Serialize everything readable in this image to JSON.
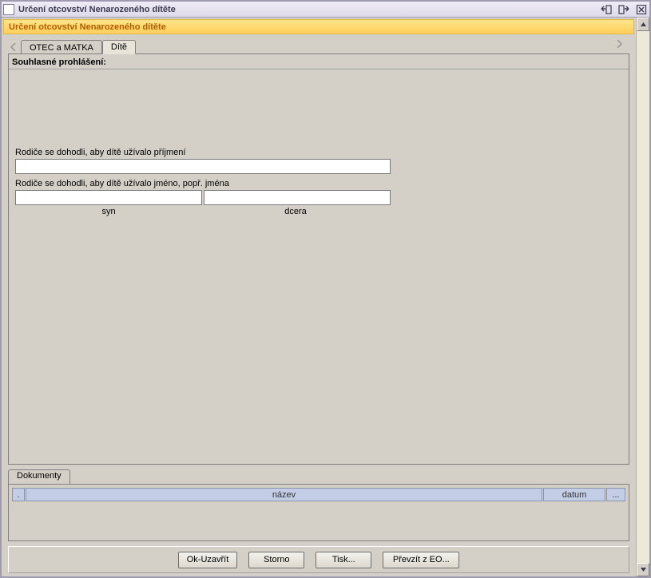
{
  "window": {
    "title": "Určení otcovství Nenarozeného dítěte"
  },
  "banner": {
    "text": "Určení otcovství Nenarozeného dítěte"
  },
  "tabs": [
    {
      "id": "parents",
      "label": "OTEC a MATKA",
      "active": false
    },
    {
      "id": "child",
      "label": "Dítě",
      "active": true
    }
  ],
  "child_panel": {
    "section_title": "Souhlasné prohlášení:",
    "surname_label": "Rodiče se dohodli, aby dítě užívalo příjmení",
    "surname_value": "",
    "name_label": "Rodiče se dohodli, aby dítě užívalo jméno, popř. jména",
    "son_value": "",
    "daughter_value": "",
    "son_caption": "syn",
    "daughter_caption": "dcera"
  },
  "documents": {
    "tab_label": "Dokumenty",
    "columns": {
      "dot": ".",
      "name": "název",
      "date": "datum",
      "more": "..."
    },
    "rows": []
  },
  "buttons": {
    "ok": "Ok-Uzavřít",
    "cancel": "Storno",
    "print": "Tisk...",
    "import": "Převzít z EO..."
  }
}
